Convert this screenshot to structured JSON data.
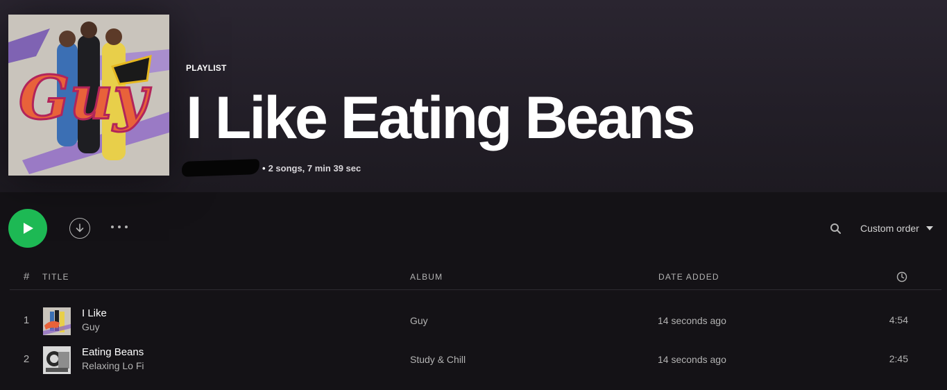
{
  "playlist": {
    "type_label": "PLAYLIST",
    "title": "I Like Eating Beans",
    "separator": "•",
    "stats": "2 songs, 7 min 39 sec",
    "cover_text": "Guy"
  },
  "controls": {
    "sort_label": "Custom order",
    "play_icon": "play-icon",
    "download_icon": "download-icon",
    "more_icon": "more-options-icon",
    "search_icon": "search-icon",
    "accent_color": "#1db954"
  },
  "table": {
    "headers": {
      "number": "#",
      "title": "TITLE",
      "album": "ALBUM",
      "date_added": "DATE ADDED",
      "duration_icon": "clock-icon"
    },
    "rows": [
      {
        "number": "1",
        "name": "I Like",
        "artist": "Guy",
        "album": "Guy",
        "added": "14 seconds ago",
        "duration": "4:54"
      },
      {
        "number": "2",
        "name": "Eating Beans",
        "artist": "Relaxing Lo Fi",
        "album": "Study & Chill",
        "added": "14 seconds ago",
        "duration": "2:45"
      }
    ]
  }
}
